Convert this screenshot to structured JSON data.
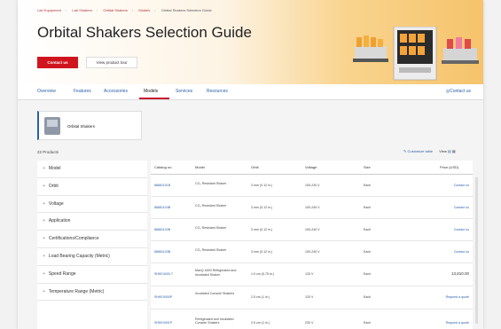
{
  "breadcrumb": [
    "Lab Equipment",
    "Lab Shakers",
    "Orbital Shakers",
    "Models",
    "Orbital Shakers Selection Guide"
  ],
  "hero": {
    "title": "Orbital Shakers Selection Guide",
    "contact_label": "Contact us",
    "tour_label": "View product tour"
  },
  "nav": {
    "tabs": [
      "Overview",
      "Features",
      "Accessories",
      "Models",
      "Services",
      "Resources"
    ],
    "active_tab": "Models",
    "contact_label": "Contact us"
  },
  "category_card": {
    "label": "Orbital Shakers"
  },
  "results": {
    "count_label": "22 Products",
    "customize_label": "Customize table",
    "view_label": "View"
  },
  "filters": [
    "Model",
    "Orbit",
    "Voltage",
    "Application",
    "Certifications/Compliance",
    "Load Bearing Capacity (Metric)",
    "Speed Range",
    "Temperature Range (Metric)"
  ],
  "table": {
    "headers": [
      "Catalog no.",
      "Model",
      "Orbit",
      "Voltage",
      "Size",
      "Price (USD)"
    ],
    "rows": [
      {
        "catalog": "88881101B",
        "model": "CO₂ Resistant Shaker",
        "orbit": "3 mm (0.12 in.)",
        "voltage": "100-240 V",
        "size": "Each",
        "price": "Contact us"
      },
      {
        "catalog": "88881104B",
        "model": "CO₂ Resistant Shaker",
        "orbit": "3 mm (0.12 in.)",
        "voltage": "100-240 V",
        "size": "Each",
        "price": "Contact us"
      },
      {
        "catalog": "88881102B",
        "model": "CO₂ Resistant Shaker",
        "orbit": "3 mm (0.12 in.)",
        "voltage": "100-240 V",
        "size": "Each",
        "price": "Contact us"
      },
      {
        "catalog": "88881103B",
        "model": "CO₂ Resistant Shaker",
        "orbit": "3 mm (0.12 in.)",
        "voltage": "100-240 V",
        "size": "Each",
        "price": "Contact us"
      },
      {
        "catalog": "SHKE4000-7",
        "model": "MaxQ 4000 Refrigerated and Incubated Shaker",
        "orbit": "1.9 cm (0.75 in.)",
        "voltage": "120 V",
        "size": "Each",
        "price": "13,810.00"
      },
      {
        "catalog": "SHKE4000P",
        "model": "Incubated Console Shakers",
        "orbit": "2.5 cm (1 in.)",
        "voltage": "120 V",
        "size": "Each",
        "price": "Request a quote"
      },
      {
        "catalog": "SHKE4001P",
        "model": "Refrigerated and Incubated Console Shakers",
        "orbit": "2.5 cm (1 in.)",
        "voltage": "230 V",
        "size": "Each",
        "price": "Request a quote"
      }
    ]
  }
}
